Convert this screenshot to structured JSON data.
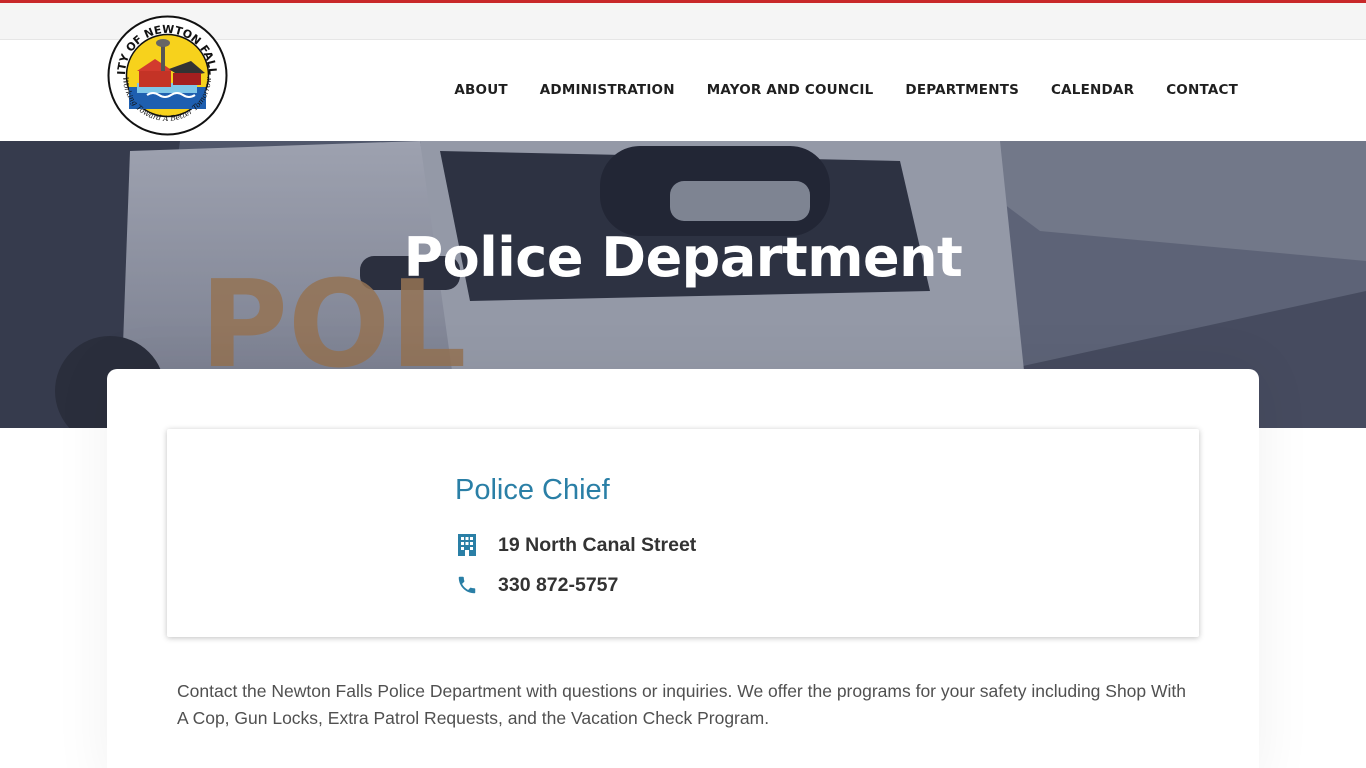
{
  "colors": {
    "top_accent": "#c8282a",
    "link_blue": "#2a7fa6",
    "nav_text": "#1f1f1f"
  },
  "logo": {
    "ring_text_top": "CITY OF NEWTON FALLS",
    "ring_text_bottom": "\"Working Toward A Better Tomorrow\""
  },
  "nav": {
    "items": [
      {
        "label": "ABOUT"
      },
      {
        "label": "ADMINISTRATION"
      },
      {
        "label": "MAYOR AND COUNCIL"
      },
      {
        "label": "DEPARTMENTS"
      },
      {
        "label": "CALENDAR"
      },
      {
        "label": "CONTACT"
      }
    ]
  },
  "hero": {
    "title": "Police Department",
    "background": "police-car-photo"
  },
  "chief": {
    "title": "Police Chief",
    "address_icon": "building-icon",
    "address": "19 North Canal Street",
    "phone_icon": "phone-icon",
    "phone": "330 872-5757"
  },
  "description": "Contact the Newton Falls Police Department with questions or inquiries. We offer the programs for your safety including Shop With A Cop, Gun Locks, Extra Patrol Requests, and the Vacation Check Program."
}
